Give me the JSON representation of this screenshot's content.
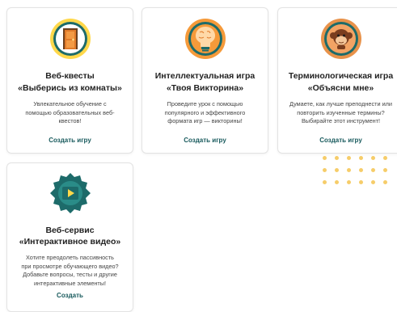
{
  "cards": [
    {
      "title_line1": "Веб-квесты",
      "title_line2": "«Выберись из комнаты»",
      "description": "Увлекательное обучение с помощью образовательных веб-квестов!",
      "cta": "Создать игру",
      "icon": "door-icon"
    },
    {
      "title_line1": "Интеллектуальная игра",
      "title_line2": "«Твоя Викторина»",
      "description": "Проведите урок с помощью популярного и эффективного формата игр — викторины!",
      "cta": "Создать игру",
      "icon": "brain-lightbulb-icon"
    },
    {
      "title_line1": "Терминологическая игра",
      "title_line2": "«Объясни мне»",
      "description": "Думаете, как лучше преподнести или повторить изученные термины? Выбирайте этот инструмент!",
      "cta": "Создать игру",
      "icon": "monkey-icon"
    },
    {
      "title_line1": "Веб-сервис",
      "title_line2": "«Интерактивное видео»",
      "description": "Хотите преодолеть пассивность при просмотре обучающего видео? Добавьте вопросы, тесты и другие интерактивные элементы!",
      "cta": "Создать",
      "icon": "video-play-icon"
    }
  ],
  "colors": {
    "accent": "#17595c",
    "dots": "#f6cd6a"
  }
}
